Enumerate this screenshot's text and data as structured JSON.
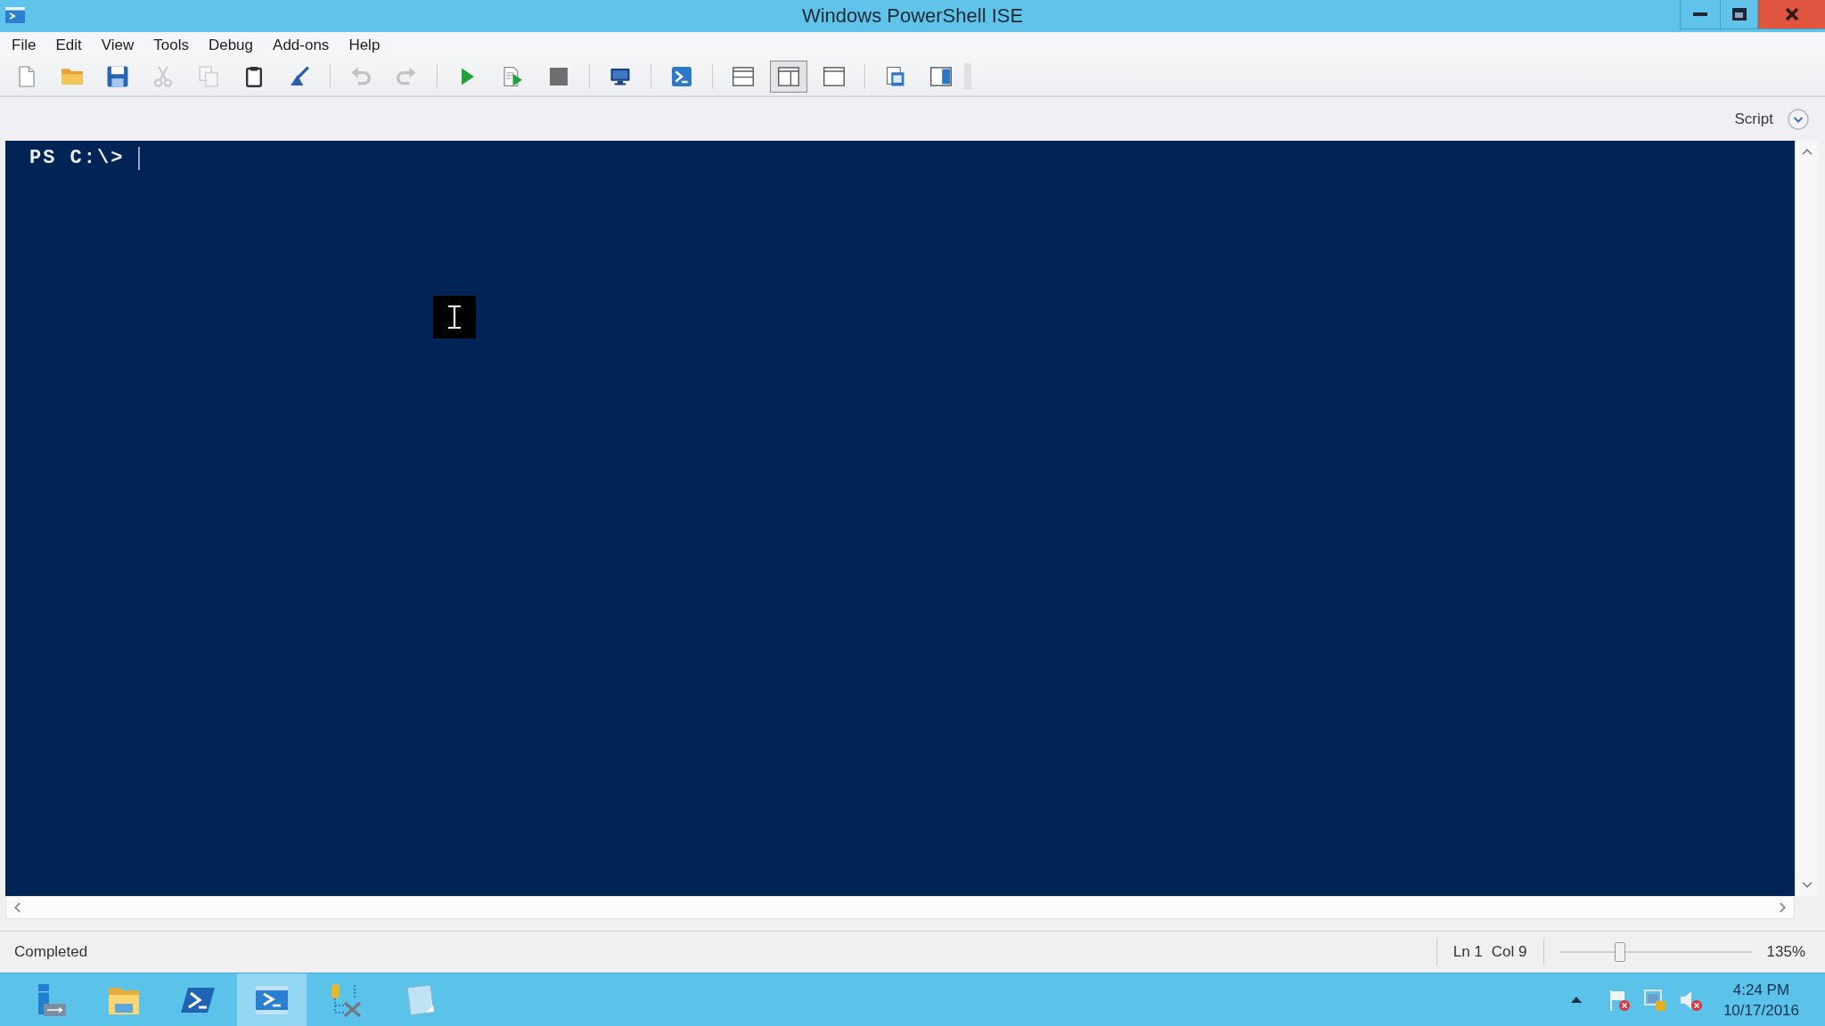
{
  "window": {
    "title": "Windows PowerShell ISE"
  },
  "menu": [
    "File",
    "Edit",
    "View",
    "Tools",
    "Debug",
    "Add-ons",
    "Help"
  ],
  "toolbar": {
    "groups": [
      {
        "buttons": [
          {
            "kind": "new",
            "disabled": false
          },
          {
            "kind": "open",
            "disabled": false
          },
          {
            "kind": "save",
            "disabled": false
          },
          {
            "kind": "cut",
            "disabled": true
          },
          {
            "kind": "copy",
            "disabled": true
          },
          {
            "kind": "paste",
            "disabled": false
          },
          {
            "kind": "clear",
            "disabled": false
          }
        ]
      },
      {
        "buttons": [
          {
            "kind": "undo",
            "disabled": true
          },
          {
            "kind": "redo",
            "disabled": true
          }
        ]
      },
      {
        "buttons": [
          {
            "kind": "run",
            "disabled": false
          },
          {
            "kind": "runselection",
            "disabled": false
          },
          {
            "kind": "stop",
            "disabled": false
          }
        ]
      },
      {
        "buttons": [
          {
            "kind": "remote",
            "disabled": false
          }
        ]
      },
      {
        "buttons": [
          {
            "kind": "console",
            "disabled": false
          }
        ]
      },
      {
        "buttons": [
          {
            "kind": "splittop",
            "disabled": false,
            "selected": false
          },
          {
            "kind": "splitright",
            "disabled": false,
            "selected": true
          },
          {
            "kind": "maximize",
            "disabled": false,
            "selected": false
          }
        ]
      },
      {
        "buttons": [
          {
            "kind": "commands",
            "disabled": false
          },
          {
            "kind": "addon",
            "disabled": false
          }
        ]
      }
    ]
  },
  "script_toggle": {
    "label": "Script",
    "expanded": false
  },
  "console": {
    "prompt": "PS C:\\>"
  },
  "status_bar": {
    "message": "Completed",
    "line": "Ln 1",
    "column": "Col 9",
    "zoom": {
      "level": 0.3,
      "reading": "135%"
    }
  },
  "taskbar": {
    "apps": [
      {
        "kind": "servermanager",
        "selected": false
      },
      {
        "kind": "explorer",
        "selected": false
      },
      {
        "kind": "powershell",
        "selected": false
      },
      {
        "kind": "ise",
        "selected": true
      },
      {
        "kind": "tools",
        "selected": false
      },
      {
        "kind": "notepad",
        "selected": false
      }
    ],
    "clock": {
      "time": "4:24 PM",
      "date": "10/17/2016"
    }
  }
}
